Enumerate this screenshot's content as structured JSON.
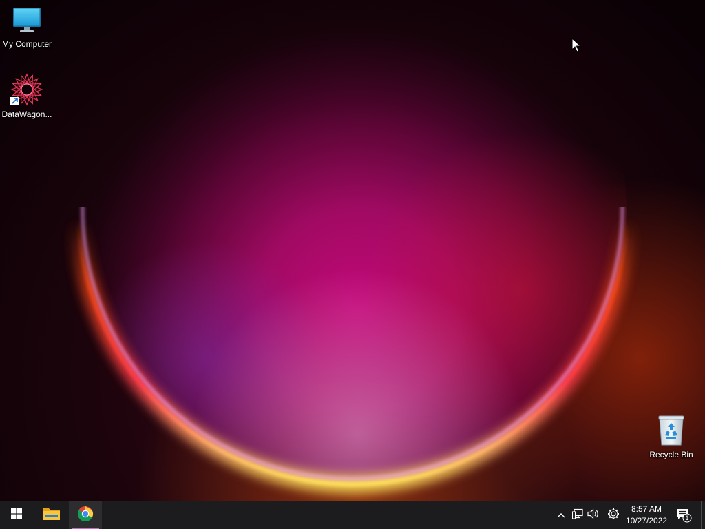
{
  "desktop": {
    "icons": [
      {
        "label": "My Computer",
        "icon": "monitor-icon"
      },
      {
        "label": "DataWagon...",
        "icon": "datawagon-icon",
        "shortcut": true
      },
      {
        "label": "Recycle Bin",
        "icon": "recycle-bin-icon"
      }
    ]
  },
  "taskbar": {
    "start_icon": "windows-logo-icon",
    "pinned": [
      {
        "name": "File Explorer",
        "icon": "folder-icon"
      },
      {
        "name": "Google Chrome",
        "icon": "chrome-icon",
        "active": true
      }
    ],
    "tray": {
      "icons": [
        "chevron-up-icon",
        "network-icon",
        "volume-icon",
        "gear-icon"
      ],
      "clock_time": "8:57 AM",
      "clock_date": "10/27/2022",
      "notification_count": "1"
    }
  },
  "colors": {
    "taskbar_bg": "#1c1c1e",
    "active_indicator": "#c46ac4"
  }
}
